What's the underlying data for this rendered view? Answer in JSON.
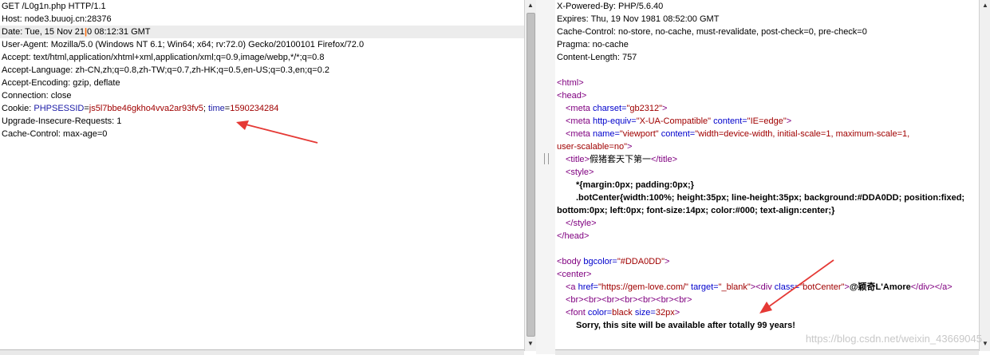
{
  "request": {
    "lines": [
      "GET /L0g1n.php HTTP/1.1",
      "Host: node3.buuoj.cn:28376",
      {
        "before": "Date: Tue, 15 Nov 21",
        "cursor": "|",
        "after": "0 08:12:31 GMT"
      },
      "User-Agent: Mozilla/5.0 (Windows NT 6.1; Win64; x64; rv:72.0) Gecko/20100101 Firefox/72.0",
      "Accept: text/html,application/xhtml+xml,application/xml;q=0.9,image/webp,*/*;q=0.8",
      "Accept-Language: zh-CN,zh;q=0.8,zh-TW;q=0.7,zh-HK;q=0.5,en-US;q=0.3,en;q=0.2",
      "Accept-Encoding: gzip, deflate",
      "Connection: close"
    ],
    "cookie": {
      "label": "Cookie: ",
      "name1": "PHPSESSID",
      "value1": "js5l7bbe46gkho4vva2ar93fv5",
      "sep": "; ",
      "name2": "time",
      "value2": "1590234284"
    },
    "tail": [
      "Upgrade-Insecure-Requests: 1",
      "Cache-Control: max-age=0"
    ]
  },
  "response": {
    "headers": [
      "X-Powered-By: PHP/5.6.40",
      "Expires: Thu, 19 Nov 1981 08:52:00 GMT",
      "Cache-Control: no-store, no-cache, must-revalidate, post-check=0, pre-check=0",
      "Pragma: no-cache",
      "Content-Length: 757"
    ],
    "html": {
      "open_html": "<html>",
      "open_head": "<head>",
      "meta_charset": {
        "open": "<meta",
        "attr": " charset=",
        "val": "\"gb2312\"",
        "close": ">"
      },
      "meta_equiv": {
        "open": "<meta",
        "attr1": " http-equiv=",
        "val1": "\"X-UA-Compatible\"",
        "attr2": " content=",
        "val2": "\"IE=edge\"",
        "close": ">"
      },
      "meta_viewport": {
        "open": "<meta",
        "attr1": " name=",
        "val1": "\"viewport\"",
        "attr2": " content=",
        "val2": "\"width=device-width, initial-scale=1, maximum-scale=1,",
        "cont": "user-scalable=no\"",
        "close": ">"
      },
      "title": {
        "open": "<title>",
        "text": "假猪套天下第一",
        "close": "</title>"
      },
      "style_open": "<style>",
      "css1": "*{margin:0px; padding:0px;}",
      "css2": ".botCenter{width:100%; height:35px; line-height:35px; background:#DDA0DD; position:fixed;",
      "css3": "bottom:0px; left:0px; font-size:14px; color:#000; text-align:center;}",
      "style_close": "</style>",
      "close_head": "</head>",
      "body": {
        "open": "<body",
        "attr": " bgcolor=",
        "val": "\"#DDA0DD\"",
        "close": ">"
      },
      "center": "<center>",
      "anchor": {
        "open": "<a",
        "attr1": " href=",
        "val1": "\"https://gem-love.com/\"",
        "attr2": " target=",
        "val2": "\"_blank\"",
        "mid": "><div",
        "attr3": " class=",
        "val3": "\"botCenter\"",
        "gt": ">",
        "text": "@颖奇L'Amore",
        "close": "</div></a>"
      },
      "brs": "<br><br><br><br><br><br><br>",
      "font": {
        "open": "<font",
        "attr1": " color=",
        "val1": "black",
        "attr2": " size=",
        "val2": "32px",
        "close": ">"
      },
      "sorry": "Sorry, this site will be available after totally 99 years!"
    }
  },
  "watermark": "https://blog.csdn.net/weixin_43669045",
  "colors": {
    "arrow": "#e53935",
    "tag": "#800080",
    "attr": "#0000cc",
    "value": "#a00000"
  }
}
